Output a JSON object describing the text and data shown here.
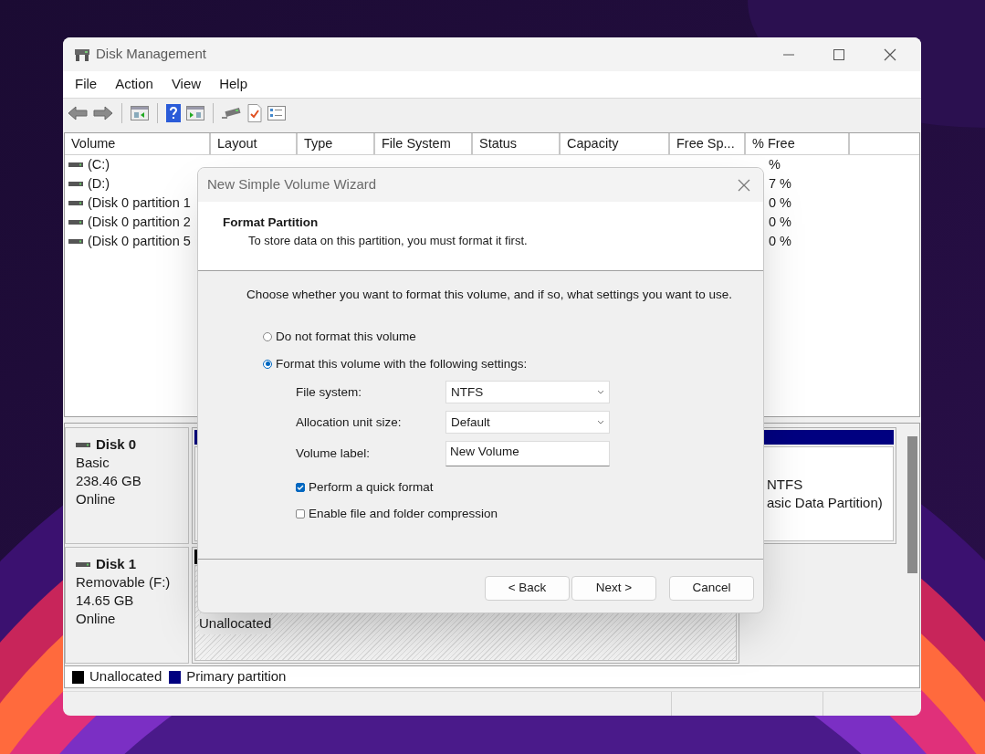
{
  "window": {
    "title": "Disk Management"
  },
  "menu": [
    "File",
    "Action",
    "View",
    "Help"
  ],
  "volume_table": {
    "columns": [
      "Volume",
      "Layout",
      "Type",
      "File System",
      "Status",
      "Capacity",
      "Free Sp...",
      "% Free"
    ],
    "rows": [
      {
        "volume": "(C:)",
        "percent_free": "%"
      },
      {
        "volume": "(D:)",
        "percent_free": "7 %"
      },
      {
        "volume": "(Disk 0 partition 1",
        "percent_free": "0 %"
      },
      {
        "volume": "(Disk 0 partition 2",
        "percent_free": "0 %"
      },
      {
        "volume": "(Disk 0 partition 5",
        "percent_free": "0 %"
      }
    ]
  },
  "disks": [
    {
      "name": "Disk 0",
      "type": "Basic",
      "size": "238.46 GB",
      "state": "Online",
      "partition": {
        "kind": "primary",
        "color": "#000080",
        "lines": [
          "NTFS",
          "asic Data Partition)"
        ]
      }
    },
    {
      "name": "Disk 1",
      "type": "Removable (F:)",
      "size": "14.65 GB",
      "state": "Online",
      "partition": {
        "kind": "unallocated",
        "color": "#000000",
        "lines": [
          "Unallocated"
        ]
      }
    }
  ],
  "legend": [
    {
      "label": "Unallocated",
      "color": "#000000"
    },
    {
      "label": "Primary partition",
      "color": "#000080"
    }
  ],
  "dialog": {
    "title": "New Simple Volume Wizard",
    "heading": "Format Partition",
    "subheading": "To store data on this partition, you must format it first.",
    "prompt": "Choose whether you want to format this volume, and if so, what settings you want to use.",
    "options": [
      {
        "label": "Do not format this volume",
        "selected": false
      },
      {
        "label": "Format this volume with the following settings:",
        "selected": true
      }
    ],
    "fields": [
      {
        "kind": "dropdown",
        "label": "File system:",
        "value": "NTFS"
      },
      {
        "kind": "dropdown",
        "label": "Allocation unit size:",
        "value": "Default"
      },
      {
        "kind": "text",
        "label": "Volume label:",
        "value": "New Volume"
      }
    ],
    "checkboxes": [
      {
        "label": "Perform a quick format",
        "checked": true
      },
      {
        "label": "Enable file and folder compression",
        "checked": false
      }
    ],
    "buttons": [
      "< Back",
      "Next >",
      "Cancel"
    ]
  }
}
